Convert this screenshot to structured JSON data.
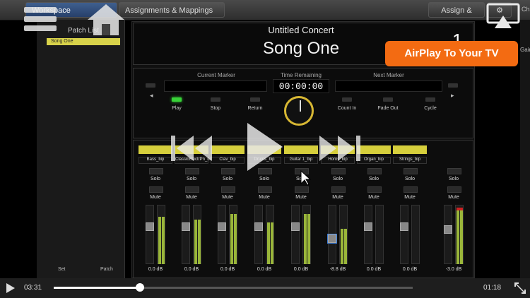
{
  "tabs": {
    "workspace": "Workspace",
    "assignments": "Assignments & Mappings"
  },
  "toolbar": {
    "assign_map": "Assign & Map",
    "gear": "⚙ ▾"
  },
  "right_edge": {
    "top_text": "Cha",
    "gain_text": "Gain"
  },
  "left_panel": {
    "title": "Patch List",
    "items": [
      "Song One"
    ],
    "set_label": "Set",
    "patch_label": "Patch"
  },
  "header": {
    "concert": "Untitled Concert",
    "song": "Song One",
    "number": "1"
  },
  "transport": {
    "current_marker_label": "Current Marker",
    "time_remaining_label": "Time Remaining",
    "next_marker_label": "Next Marker",
    "time_remaining": "00:00:00",
    "left_arrow": "◂",
    "right_arrow": "▸",
    "controls": [
      "Play",
      "Stop",
      "Return",
      "Count In",
      "Fade Out",
      "Cycle"
    ]
  },
  "mixer": {
    "channels": [
      {
        "name": "Bass_bip",
        "db": "0.0 dB",
        "fader": 0.7,
        "meter": 0.8
      },
      {
        "name": "ClassicElectrPn_bip",
        "db": "0.0 dB",
        "fader": 0.7,
        "meter": 0.75
      },
      {
        "name": "Clav_bip",
        "db": "0.0 dB",
        "fader": 0.7,
        "meter": 0.85
      },
      {
        "name": "Drums_bip",
        "db": "0.0 dB",
        "fader": 0.7,
        "meter": 0.7
      },
      {
        "name": "Guitar 1_bip",
        "db": "0.0 dB",
        "fader": 0.7,
        "meter": 0.85
      },
      {
        "name": "Horns_bip",
        "db": "-8.8 dB",
        "fader": 0.5,
        "meter": 0.6
      },
      {
        "name": "Organ_bip",
        "db": "0.0 dB",
        "fader": 0.7,
        "meter": 0.0
      },
      {
        "name": "Strings_bip",
        "db": "0.0 dB",
        "fader": 0.7,
        "meter": 0.0
      },
      {
        "name": "",
        "db": "-3.0 dB",
        "fader": 0.65,
        "meter": 0.95
      }
    ],
    "solo_label": "Solo",
    "mute_label": "Mute"
  },
  "airplay": {
    "badge": "AirPlay To Your TV"
  },
  "player": {
    "elapsed": "03:31",
    "remaining": "01:18",
    "progress": 0.24
  },
  "colors": {
    "accent_orange": "#f36b12",
    "region_yellow": "#d6cf3c",
    "meter_green": "#9ab63a",
    "led_green": "#38d238"
  },
  "icons": [
    "menu-icon",
    "home-icon",
    "airplay-icon",
    "rewind-icon",
    "play-icon",
    "fast-forward-icon",
    "player-play-icon",
    "fullscreen-icon"
  ]
}
